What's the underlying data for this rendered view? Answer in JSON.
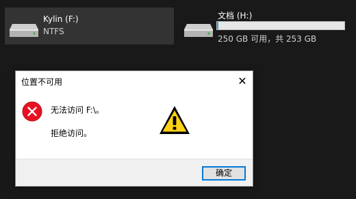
{
  "drives": [
    {
      "name": "Kylin (F:)",
      "subtitle": "NTFS",
      "icon": "hard-drive-icon"
    },
    {
      "name": "文档 (H:)",
      "usage_text": "250 GB 可用，共 253 GB",
      "used_fraction": 0.012,
      "bar_color": "#26a0da",
      "icon": "hard-drive-icon"
    }
  ],
  "dialog": {
    "title": "位置不可用",
    "close_glyph": "✕",
    "message_line1": "无法访问 F:\\。",
    "message_line2": "拒绝访问。",
    "error_icon": "error-icon",
    "warning_icon": "warning-icon",
    "ok_label": "确定"
  },
  "colors": {
    "background": "#191919",
    "selected_tile": "#333333",
    "error_red": "#e81123",
    "warning_yellow": "#fcd116",
    "accent": "#0078d7"
  }
}
